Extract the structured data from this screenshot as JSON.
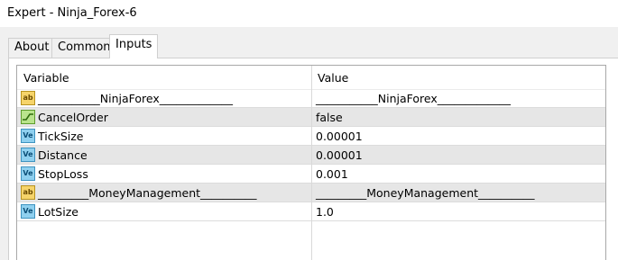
{
  "window": {
    "title": "Expert - Ninja_Forex-6"
  },
  "tabs": [
    {
      "label": "About",
      "active": false
    },
    {
      "label": "Common",
      "active": false
    },
    {
      "label": "Inputs",
      "active": true
    }
  ],
  "grid": {
    "columns": [
      "Variable",
      "Value"
    ],
    "rows": [
      {
        "icon": "string-icon",
        "name": "___________NinjaForex_____________",
        "value": "___________NinjaForex_____________",
        "shaded": false
      },
      {
        "icon": "bool-icon",
        "name": "CancelOrder",
        "value": "false",
        "shaded": true
      },
      {
        "icon": "double-icon",
        "name": "TickSize",
        "value": "0.00001",
        "shaded": false
      },
      {
        "icon": "double-icon",
        "name": "Distance",
        "value": "0.00001",
        "shaded": true
      },
      {
        "icon": "double-icon",
        "name": "StopLoss",
        "value": "0.001",
        "shaded": false
      },
      {
        "icon": "string-icon",
        "name": "_________MoneyManagement__________",
        "value": "_________MoneyManagement__________",
        "shaded": true
      },
      {
        "icon": "double-icon",
        "name": "LotSize",
        "value": "1.0",
        "shaded": false
      }
    ]
  }
}
